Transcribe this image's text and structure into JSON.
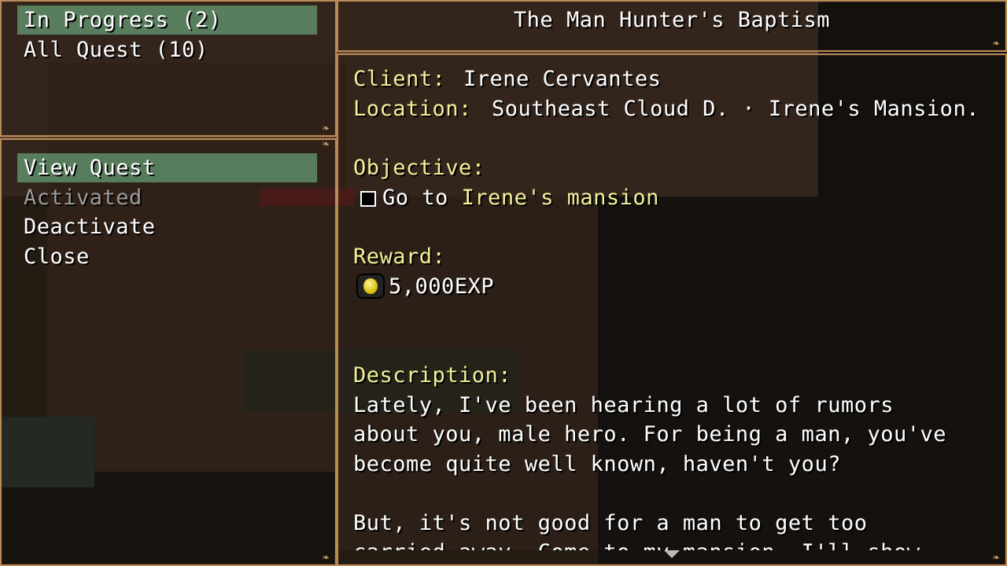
{
  "category_menu": {
    "items": [
      {
        "label": "In Progress (2)",
        "selected": true
      },
      {
        "label": "All Quest (10)",
        "selected": false
      }
    ]
  },
  "command_menu": {
    "items": [
      {
        "label": "View Quest",
        "selected": true,
        "enabled": true
      },
      {
        "label": "Activated",
        "selected": false,
        "enabled": false
      },
      {
        "label": "Deactivate",
        "selected": false,
        "enabled": true
      },
      {
        "label": "Close",
        "selected": false,
        "enabled": true
      }
    ]
  },
  "quest": {
    "title": "The Man Hunter's Baptism",
    "client_label": "Client:",
    "client_value": "Irene Cervantes",
    "location_label": "Location:",
    "location_value": "Southeast Cloud D. · Irene's Mansion.",
    "objective_label": "Objective:",
    "objective_prefix": "Go to",
    "objective_target": "Irene's mansion",
    "reward_label": "Reward:",
    "reward_value": "5,000EXP",
    "description_label": "Description:",
    "description_lines": [
      "Lately, I've been hearing a lot of rumors",
      "about you, male hero. For being a man, you've",
      "become quite well known, haven't you?",
      "",
      "But, it's not good for a man to get too",
      "carried away. Come to my mansion. I'll show"
    ]
  },
  "colors": {
    "label_yellow": "#f2f098",
    "selection_green": "#78c896",
    "frame_gold": "#b88a58"
  },
  "icons": {
    "reward": "exp-orb-icon",
    "scroll": "scroll-down-arrow-icon",
    "objective_status": "checkbox-empty-icon"
  }
}
